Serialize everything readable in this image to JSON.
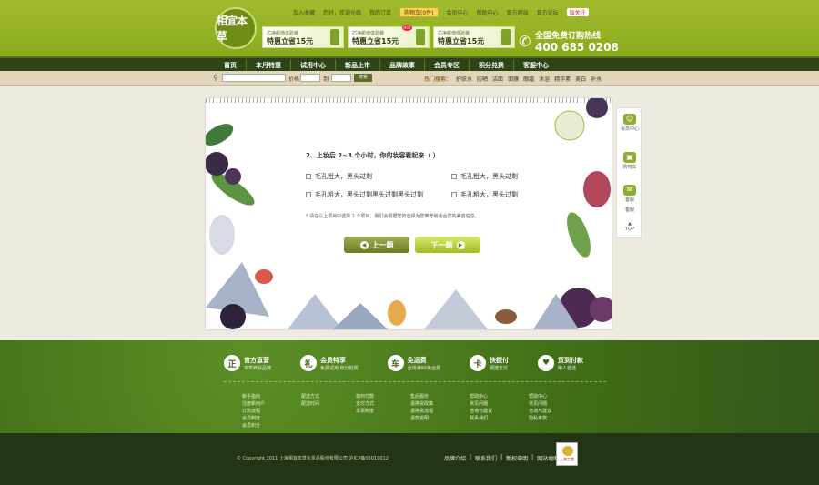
{
  "header": {
    "logo_text": "相宜本草",
    "toplinks": [
      "加入收藏",
      "您好，欢迎光临",
      "我的订单",
      "购物车(0件)",
      "会员中心",
      "帮助中心",
      "官方网站",
      "官方论坛",
      "加关注"
    ],
    "banners": [
      {
        "line1": "芯净颜值体验装",
        "line2": "特惠立省15元"
      },
      {
        "line1": "芯净颜值体验装",
        "line2": "特惠立省15元"
      },
      {
        "line1": "芯净颜值体验装",
        "line2": "特惠立省15元"
      }
    ],
    "banner_hot": "HOT",
    "hotline_title": "全国免费订购热线",
    "hotline_number": "400 685 0208"
  },
  "nav": [
    "首页",
    "本月特惠",
    "试用中心",
    "新品上市",
    "品牌故事",
    "会员专区",
    "积分兑换",
    "客服中心"
  ],
  "search": {
    "price_label": "价格",
    "price_sep": "到",
    "button": "搜索",
    "hot_label": "热门搜索：",
    "hot_terms": [
      "护肤水",
      "防晒",
      "洁面",
      "面膜",
      "眼霜",
      "沐浴",
      "精华素",
      "美白",
      "补水"
    ]
  },
  "quiz": {
    "question": "2、上妆后 2~3 个小时，你的妆容看起来（ ）",
    "options": [
      "毛孔粗大，黑头过剩",
      "毛孔粗大，黑头过剩",
      "毛孔粗大，黑头过剩黑头过剩黑头过剩",
      "毛孔粗大，黑头过剩"
    ],
    "note": "* 请在以上项目中选择 1 个项目，我们会根据您的选择为您推荐最适合您的美容信息。",
    "prev_label": "上一题",
    "next_label": "下一题"
  },
  "sidebar": {
    "items": [
      "会员中心",
      "购物车",
      "客服",
      "客服"
    ],
    "top_label": "TOP"
  },
  "footer": {
    "features": [
      {
        "icon": "正",
        "title": "官方直营",
        "sub": "本草养肤品牌"
      },
      {
        "icon": "礼",
        "title": "会员特享",
        "sub": "免费试用 积分抵现"
      },
      {
        "icon": "车",
        "title": "免运费",
        "sub": "全场满99免运费"
      },
      {
        "icon": "卡",
        "title": "快捷付",
        "sub": "便捷支付"
      },
      {
        "icon": "♥",
        "title": "货到付款",
        "sub": "懒人首选"
      }
    ],
    "link_columns": [
      [
        "新手指南",
        "注册新用户",
        "订购流程",
        "会员制度",
        "会员积分"
      ],
      [
        "配送方式",
        "配送时间"
      ],
      [
        "如何付款",
        "支付方式",
        "发票制度"
      ],
      [
        "售后服务",
        "退换货政策",
        "退换货流程",
        "退款说明"
      ],
      [
        "帮助中心",
        "常见问题",
        "咨询与建议",
        "联系我们"
      ],
      [
        "帮助中心",
        "常见问题",
        "咨询与建议",
        "隐私条款"
      ]
    ],
    "copyright": "© Copyright 2011 上海相宜本草化妆品股份有限公司 沪ICP备05019012",
    "bottom_links": [
      "品牌介绍",
      "|",
      "联系我们",
      "|",
      "新权申明",
      "|",
      "网站地图"
    ],
    "badge_text": "上海工商"
  }
}
